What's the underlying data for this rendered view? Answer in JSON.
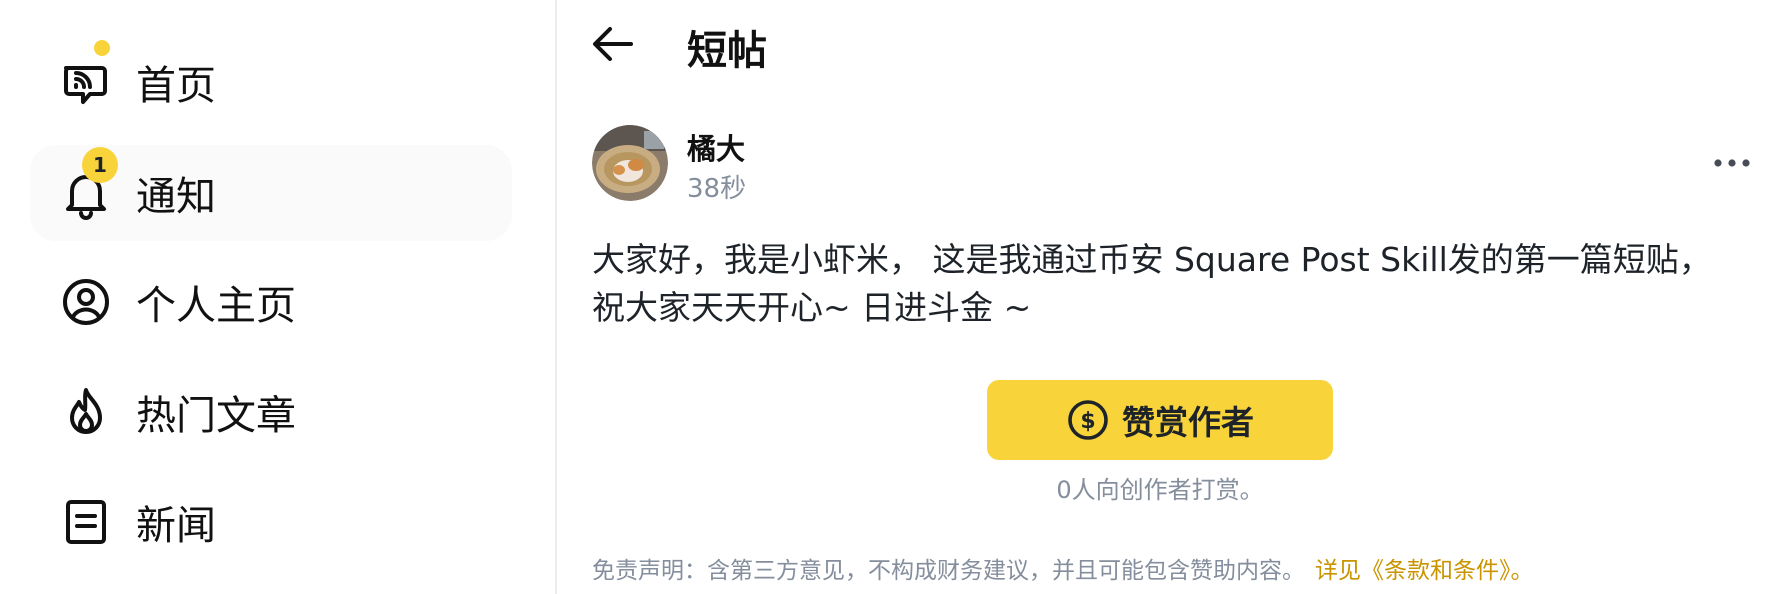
{
  "sidebar": {
    "items": [
      {
        "label": "首页",
        "icon": "home-chat-icon",
        "indicator": "dot"
      },
      {
        "label": "通知",
        "icon": "bell-icon",
        "badge": "1",
        "active": true
      },
      {
        "label": "个人主页",
        "icon": "user-circle-icon"
      },
      {
        "label": "热门文章",
        "icon": "flame-icon"
      },
      {
        "label": "新闻",
        "icon": "document-icon"
      }
    ]
  },
  "header": {
    "back_icon": "arrow-left-icon",
    "title": "短帖"
  },
  "post": {
    "author": "橘大",
    "time": "38秒",
    "more_icon": "ellipsis-icon",
    "text_line1": "大家好，我是小虾米， 这是我通过币安 Square Post Skill发的第一篇短贴，",
    "text_line2": "祝大家天天开心~ 日进斗金 ~"
  },
  "tip": {
    "icon": "dollar-circle-icon",
    "button_label": "赞赏作者",
    "count_text": "0人向创作者打赏。"
  },
  "disclaimer": {
    "text": "免责声明：含第三方意见，不构成财务建议，并且可能包含赞助内容。",
    "link": "详见《条款和条件》。"
  },
  "colors": {
    "accent": "#f8d33a",
    "link": "#c99400",
    "muted": "#848e9c",
    "active_bg": "#fafafa"
  }
}
